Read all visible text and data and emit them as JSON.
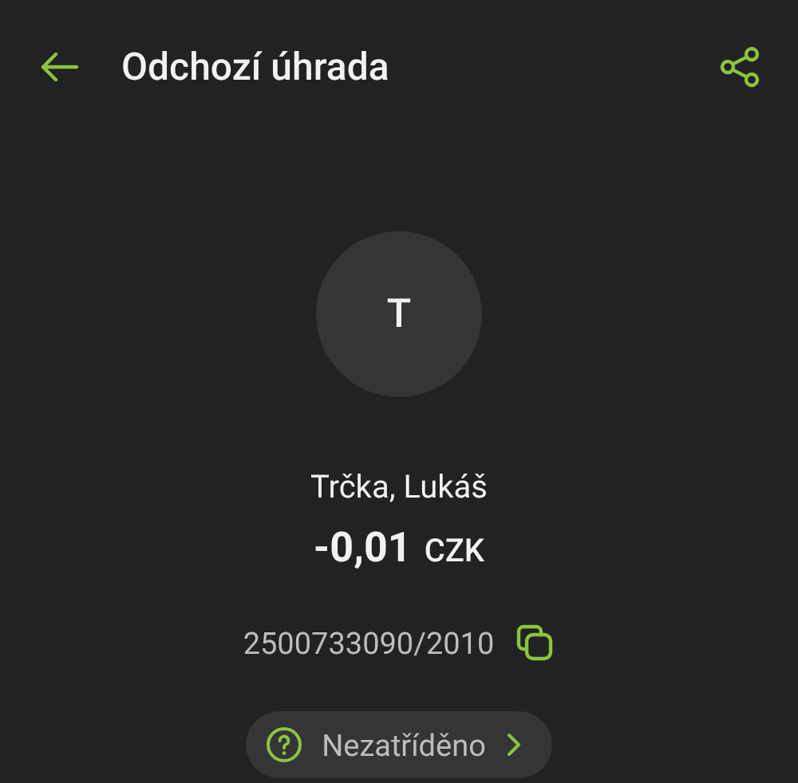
{
  "header": {
    "title": "Odchozí úhrada"
  },
  "avatar": {
    "initial": "T"
  },
  "counterparty": {
    "name": "Trčka, Lukáš",
    "amount": "-0,01",
    "currency": "CZK",
    "account": "2500733090/2010"
  },
  "category": {
    "label": "Nezatříděno"
  }
}
